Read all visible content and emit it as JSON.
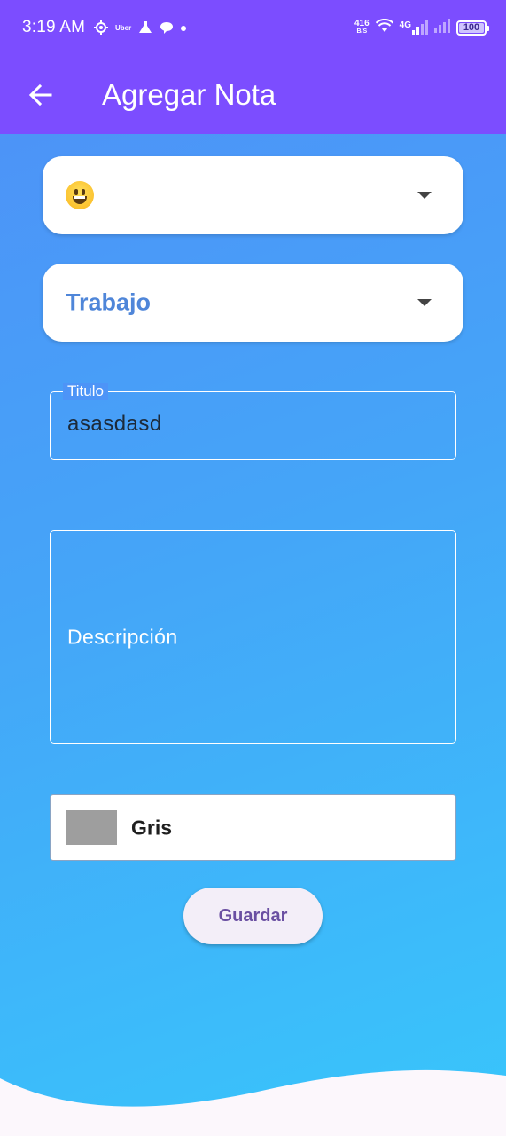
{
  "status_bar": {
    "time": "3:19 AM",
    "notification_icons": [
      "gear-icon",
      "uber-icon",
      "flask-icon",
      "chat-bubble-icon",
      "dot-icon"
    ],
    "uber_label": "Uber",
    "net_speed_value": "416",
    "net_speed_unit": "B/S",
    "network_type": "4G",
    "battery_level": "100"
  },
  "app_bar": {
    "title": "Agregar Nota",
    "back_icon": "arrow-left-icon"
  },
  "form": {
    "emoji_dropdown": {
      "selected": "😀",
      "icon": "grinning-face-emoji"
    },
    "category_dropdown": {
      "selected": "Trabajo"
    },
    "title_field": {
      "label": "Titulo",
      "value": "asasdasd"
    },
    "description_field": {
      "placeholder": "Descripción"
    },
    "color_select": {
      "selected_label": "Gris",
      "swatch_color": "#9e9e9e"
    },
    "save_label": "Guardar"
  },
  "colors": {
    "app_bar": "#7c4dff",
    "gradient_top": "#4f8ff7",
    "gradient_bottom": "#38c6fb",
    "accent_text": "#4f86d9",
    "button_text": "#6a4fa2"
  }
}
